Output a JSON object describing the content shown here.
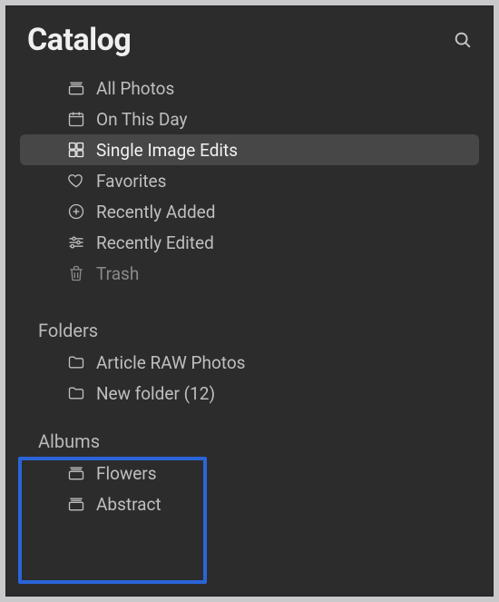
{
  "header": {
    "title": "Catalog",
    "search_icon_name": "search"
  },
  "catalog": {
    "items": [
      {
        "label": "All Photos",
        "icon": "stack",
        "selected": false,
        "dim": false
      },
      {
        "label": "On This Day",
        "icon": "calendar",
        "selected": false,
        "dim": false
      },
      {
        "label": "Single Image Edits",
        "icon": "grid",
        "selected": true,
        "dim": false
      },
      {
        "label": "Favorites",
        "icon": "heart",
        "selected": false,
        "dim": false
      },
      {
        "label": "Recently Added",
        "icon": "plus",
        "selected": false,
        "dim": false
      },
      {
        "label": "Recently Edited",
        "icon": "sliders",
        "selected": false,
        "dim": false
      },
      {
        "label": "Trash",
        "icon": "trash",
        "selected": false,
        "dim": true
      }
    ]
  },
  "folders": {
    "title": "Folders",
    "items": [
      {
        "label": "Article RAW Photos",
        "icon": "folder"
      },
      {
        "label": "New folder (12)",
        "icon": "folder"
      }
    ]
  },
  "albums": {
    "title": "Albums",
    "items": [
      {
        "label": "Flowers",
        "icon": "stack"
      },
      {
        "label": "Abstract",
        "icon": "stack"
      }
    ]
  },
  "colors": {
    "highlight_border": "#2b64d8",
    "selected_bg": "#474747",
    "panel_bg": "#2c2c2c"
  }
}
